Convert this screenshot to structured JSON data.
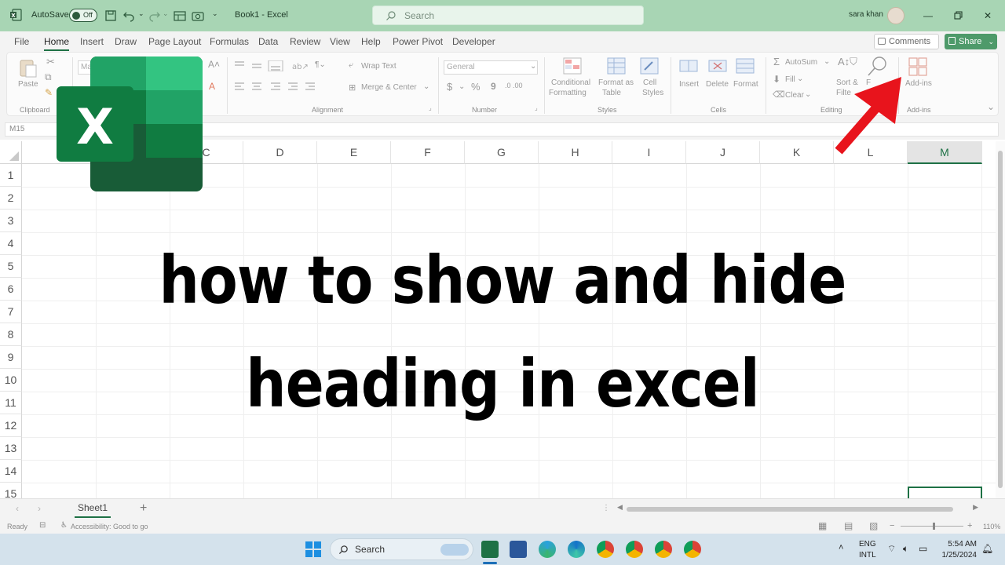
{
  "titlebar": {
    "autosave_label": "AutoSave",
    "autosave_state": "Off",
    "doc_title": "Book1  -  Excel",
    "search_placeholder": "Search",
    "user_name": "sara khan"
  },
  "menu": {
    "tabs": [
      "File",
      "Home",
      "Insert",
      "Draw",
      "Page Layout",
      "Formulas",
      "Data",
      "Review",
      "View",
      "Help",
      "Power Pivot",
      "Developer"
    ],
    "active_tab": "Home",
    "comments_label": "Comments",
    "share_label": "Share"
  },
  "ribbon": {
    "clipboard": {
      "paste": "Paste",
      "group": "Clipboard"
    },
    "font": {
      "font_name": "Ma"
    },
    "alignment": {
      "wrap_text": "Wrap Text",
      "merge_center": "Merge & Center",
      "group": "Alignment"
    },
    "number": {
      "format": "General",
      "dollar": "$",
      "percent": "%",
      "comma": "9",
      "group": "Number"
    },
    "styles": {
      "conditional": "Conditional",
      "conditional2": "Formatting",
      "format_as": "Format as",
      "format_as2": "Table",
      "cell": "Cell",
      "cell2": "Styles",
      "group": "Styles"
    },
    "cells": {
      "insert": "Insert",
      "delete": "Delete",
      "format": "Format",
      "group": "Cells"
    },
    "editing": {
      "autosum": "AutoSum",
      "fill": "Fill",
      "clear": "Clear",
      "sort": "Sort &",
      "filter": "Filte",
      "find": "F",
      "group": "Editing"
    },
    "addins": {
      "label": "Add-ins",
      "group": "Add-ins"
    }
  },
  "formula_bar": {
    "name_box": "M15"
  },
  "grid": {
    "columns": [
      "C",
      "D",
      "E",
      "F",
      "G",
      "H",
      "I",
      "J",
      "K",
      "L",
      "M"
    ],
    "selected_column": "M",
    "rows": [
      "1",
      "2",
      "3",
      "4",
      "5",
      "6",
      "7",
      "8",
      "9",
      "10",
      "11",
      "12",
      "13",
      "14",
      "15"
    ]
  },
  "sheets": {
    "tabs": [
      "Sheet1"
    ],
    "active": "Sheet1",
    "add": "+"
  },
  "status": {
    "ready": "Ready",
    "accessibility": "Accessibility: Good to go",
    "zoom": "110%"
  },
  "overlay": {
    "logo_letter": "X",
    "caption_line1": "how to show and hide",
    "caption_line2": "heading in excel"
  },
  "taskbar": {
    "search_label": "Search",
    "lang_top": "ENG",
    "lang_bottom": "INTL",
    "time": "5:54 AM",
    "date": "1/25/2024"
  },
  "colors": {
    "accent": "#1e7145",
    "titlebar": "#a8d5b4",
    "arrow": "#e8141c"
  }
}
